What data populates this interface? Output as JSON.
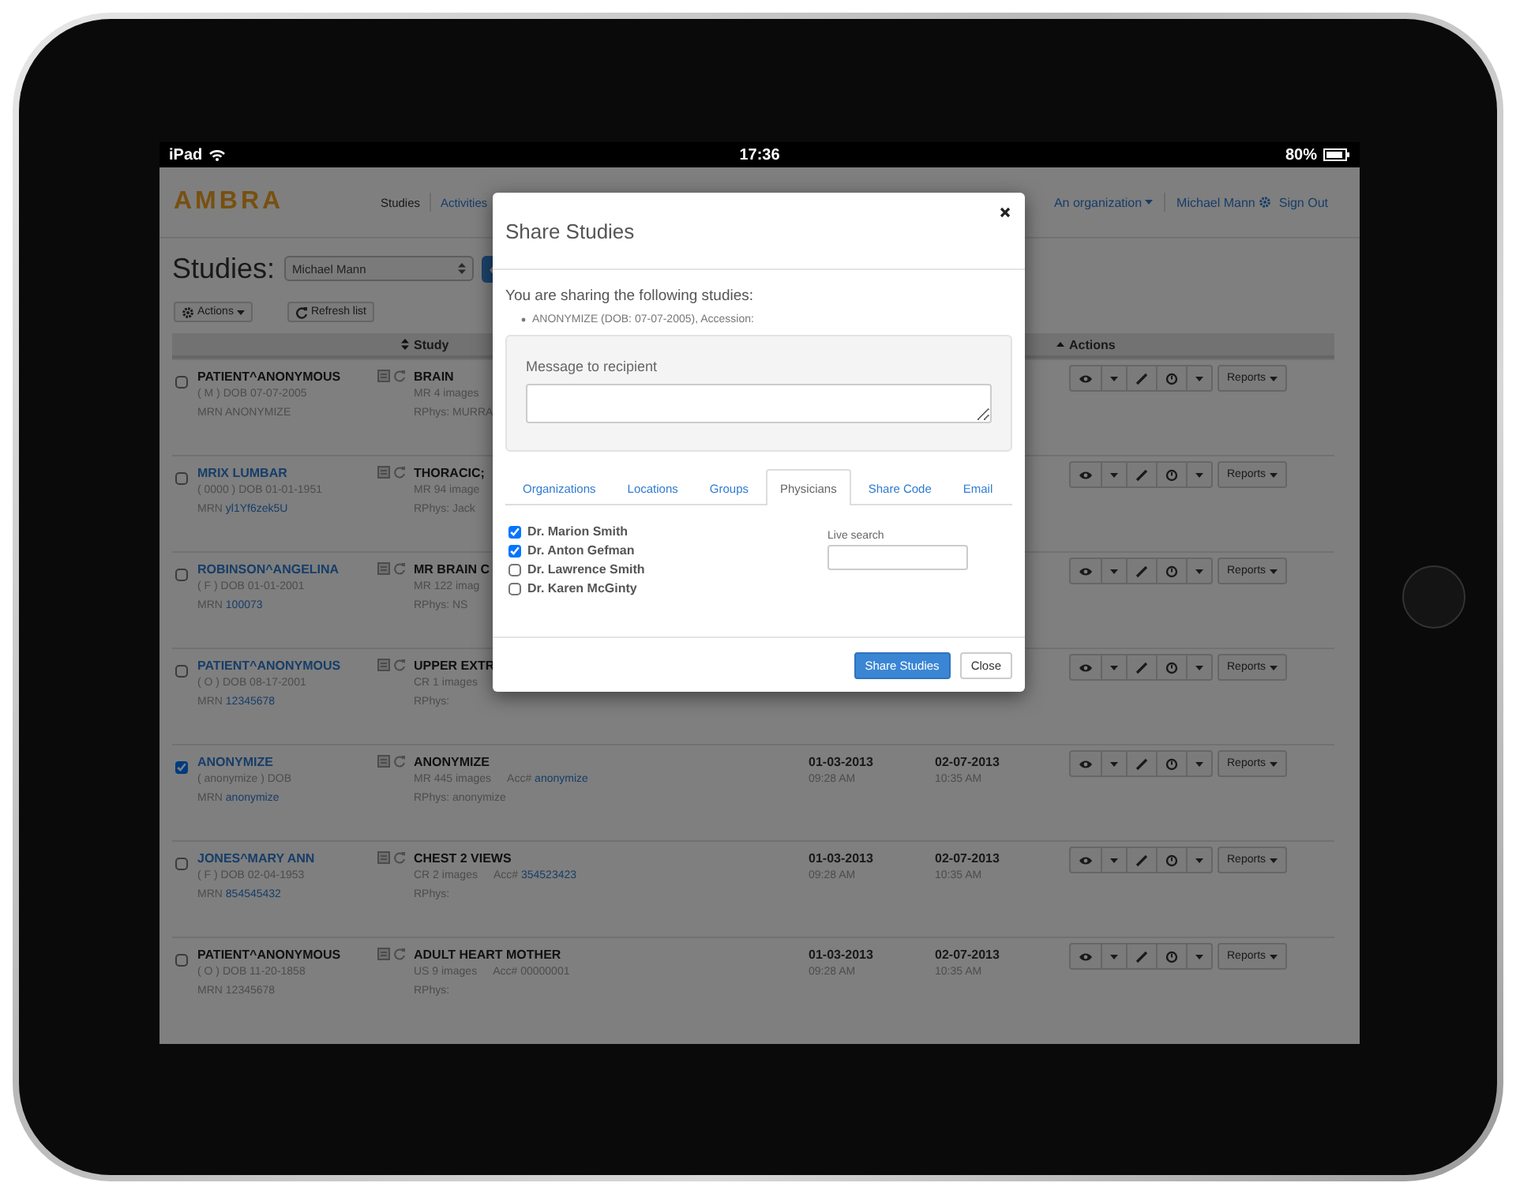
{
  "status_bar": {
    "device": "iPad",
    "time": "17:36",
    "battery": "80%"
  },
  "header": {
    "logo": "AMBRA",
    "nav": [
      {
        "label": "Studies",
        "selected": true
      },
      {
        "label": "Activities",
        "selected": false
      }
    ],
    "organization": "An organization",
    "user": "Michael Mann",
    "sign_out": "Sign Out"
  },
  "toolbar": {
    "title": "Studies:",
    "user_select": "Michael Mann",
    "actions_button": "Actions",
    "refresh_button": "Refresh list"
  },
  "table": {
    "columns": [
      {
        "label": "Study"
      },
      {
        "label": "Actions"
      }
    ],
    "rows": [
      {
        "selected": false,
        "patient_name": "PATIENT^ANONYMOUS",
        "patient_link": false,
        "demographics": "( M ) DOB 07-07-2005",
        "mrn_label": "MRN",
        "mrn": "ANONYMIZE",
        "mrn_link": false,
        "study": "BRAIN",
        "images": "MR 4 images",
        "physician": "RPhys: MURRA",
        "reports": "Reports"
      },
      {
        "selected": false,
        "patient_name": "MRIX LUMBAR",
        "patient_link": true,
        "demographics": "( 0000 ) DOB 01-01-1951",
        "mrn_label": "MRN",
        "mrn": "yl1Yf6zek5U",
        "mrn_link": true,
        "study": "THORACIC;",
        "images": "MR 94 image",
        "physician": "RPhys: Jack",
        "reports": "Reports"
      },
      {
        "selected": false,
        "patient_name": "ROBINSON^ANGELINA",
        "patient_link": true,
        "demographics": "( F ) DOB 01-01-2001",
        "mrn_label": "MRN",
        "mrn": "100073",
        "mrn_link": true,
        "study": "MR BRAIN C",
        "images": "MR 122 imag",
        "physician": "RPhys: NS",
        "reports": "Reports"
      },
      {
        "selected": false,
        "patient_name": "PATIENT^ANONYMOUS",
        "patient_link": true,
        "demographics": "( O ) DOB 08-17-2001",
        "mrn_label": "MRN",
        "mrn": "12345678",
        "mrn_link": true,
        "study": "UPPER EXTR",
        "images": "CR 1 images",
        "physician": "RPhys:",
        "reports": "Reports"
      },
      {
        "selected": true,
        "patient_name": "ANONYMIZE",
        "patient_link": true,
        "demographics": "( anonymize ) DOB",
        "mrn_label": "MRN",
        "mrn": "anonymize",
        "mrn_link": true,
        "study": "ANONYMIZE",
        "images": "MR 445 images",
        "acc_label": "Acc#",
        "accession": "anonymize",
        "acc_link": true,
        "physician": "RPhys: anonymize",
        "study_date": "01-03-2013",
        "study_time": "09:28 AM",
        "upload_date": "02-07-2013",
        "upload_time": "10:35 AM",
        "reports": "Reports"
      },
      {
        "selected": false,
        "patient_name": "JONES^MARY ANN",
        "patient_link": true,
        "demographics": "( F ) DOB 02-04-1953",
        "mrn_label": "MRN",
        "mrn": "854545432",
        "mrn_link": true,
        "study": "CHEST 2 VIEWS",
        "images": "CR 2 images",
        "acc_label": "Acc#",
        "accession": "354523423",
        "acc_link": true,
        "physician": "RPhys:",
        "study_date": "01-03-2013",
        "study_time": "09:28 AM",
        "upload_date": "02-07-2013",
        "upload_time": "10:35 AM",
        "reports": "Reports"
      },
      {
        "selected": false,
        "patient_name": "PATIENT^ANONYMOUS",
        "patient_link": false,
        "demographics": "( O ) DOB 11-20-1858",
        "mrn_label": "MRN",
        "mrn": "12345678",
        "mrn_link": false,
        "study": "ADULT HEART MOTHER",
        "images": "US 9 images",
        "acc_label": "Acc#",
        "accession": "00000001",
        "acc_link": false,
        "physician": "RPhys:",
        "study_date": "01-03-2013",
        "study_time": "09:28 AM",
        "upload_date": "02-07-2013",
        "upload_time": "10:35 AM",
        "reports": "Reports"
      }
    ]
  },
  "modal": {
    "title": "Share Studies",
    "intro": "You are sharing the following studies:",
    "studies": [
      "ANONYMIZE (DOB: 07-07-2005), Accession:"
    ],
    "message_label": "Message to recipient",
    "tabs": [
      {
        "label": "Organizations",
        "selected": false
      },
      {
        "label": "Locations",
        "selected": false
      },
      {
        "label": "Groups",
        "selected": false
      },
      {
        "label": "Physicians",
        "selected": true
      },
      {
        "label": "Share Code",
        "selected": false
      },
      {
        "label": "Email",
        "selected": false
      }
    ],
    "physicians": [
      {
        "name": "Dr. Marion Smith",
        "checked": true
      },
      {
        "name": "Dr. Anton Gefman",
        "checked": true
      },
      {
        "name": "Dr. Lawrence Smith",
        "checked": false
      },
      {
        "name": "Dr. Karen McGinty",
        "checked": false
      }
    ],
    "search_label": "Live search",
    "buttons": [
      {
        "label": "Share Studies",
        "kind": "primary"
      },
      {
        "label": "Close",
        "kind": "default"
      }
    ]
  }
}
